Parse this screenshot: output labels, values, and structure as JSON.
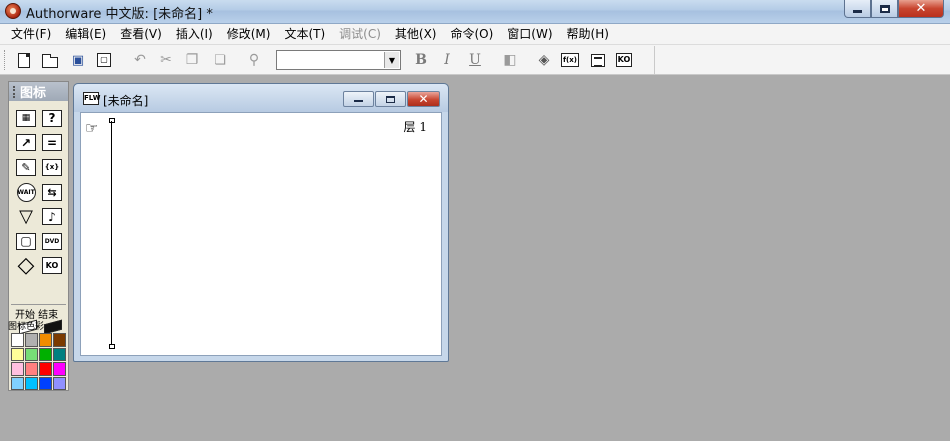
{
  "window": {
    "title": "Authorware 中文版: [未命名] *",
    "close_glyph": "✕"
  },
  "menu": [
    {
      "label": "文件(F)",
      "enabled": true
    },
    {
      "label": "编辑(E)",
      "enabled": true
    },
    {
      "label": "查看(V)",
      "enabled": true
    },
    {
      "label": "插入(I)",
      "enabled": true
    },
    {
      "label": "修改(M)",
      "enabled": true
    },
    {
      "label": "文本(T)",
      "enabled": true
    },
    {
      "label": "调试(C)",
      "enabled": false
    },
    {
      "label": "其他(X)",
      "enabled": true
    },
    {
      "label": "命令(O)",
      "enabled": true
    },
    {
      "label": "窗口(W)",
      "enabled": true
    },
    {
      "label": "帮助(H)",
      "enabled": true
    }
  ],
  "toolbar": {
    "bold": "B",
    "italic": "I",
    "underline": "U",
    "fx_label": "f(x)",
    "ko_label": "KO",
    "font_value": "",
    "font_arrow": "▼",
    "undo": "↶",
    "cut": "✂",
    "copy": "❐",
    "paste": "📋",
    "find": "⚲",
    "run": "◧",
    "control": "◈"
  },
  "palette": {
    "title": "图标",
    "icons": [
      {
        "name": "display-icon",
        "glyph": "🖼"
      },
      {
        "name": "decision-icon",
        "glyph": "?"
      },
      {
        "name": "motion-icon",
        "glyph": "↗"
      },
      {
        "name": "interaction-icon",
        "glyph": "="
      },
      {
        "name": "erase-icon",
        "glyph": "✎"
      },
      {
        "name": "calculation-icon",
        "glyph": "◫"
      },
      {
        "name": "wait-icon",
        "glyph": "WAIT"
      },
      {
        "name": "navigation-icon",
        "glyph": "⇆"
      },
      {
        "name": "framework-icon",
        "glyph": "▽"
      },
      {
        "name": "sound-icon",
        "glyph": "♪"
      },
      {
        "name": "map-icon",
        "glyph": "▢"
      },
      {
        "name": "video-icon",
        "glyph": "DVD"
      },
      {
        "name": "group-icon",
        "glyph": "◇"
      },
      {
        "name": "knowledge-object-icon",
        "glyph": "KO"
      }
    ],
    "flag_label": "开始 结束",
    "color_label": "图标色彩",
    "colors": [
      "#ffffff",
      "#b0b0b0",
      "#f08c00",
      "#7a3a00",
      "#ffff99",
      "#77dd77",
      "#00b000",
      "#008080",
      "#ffc0e0",
      "#ff8080",
      "#ff0000",
      "#ff00ff",
      "#80d0ff",
      "#00c0ff",
      "#0040ff",
      "#9090ff"
    ]
  },
  "flow_window": {
    "title": "[未命名]",
    "icon_label": "FLW",
    "layer_label": "层 1",
    "close_glyph": "✕",
    "hand_glyph": "☞"
  }
}
